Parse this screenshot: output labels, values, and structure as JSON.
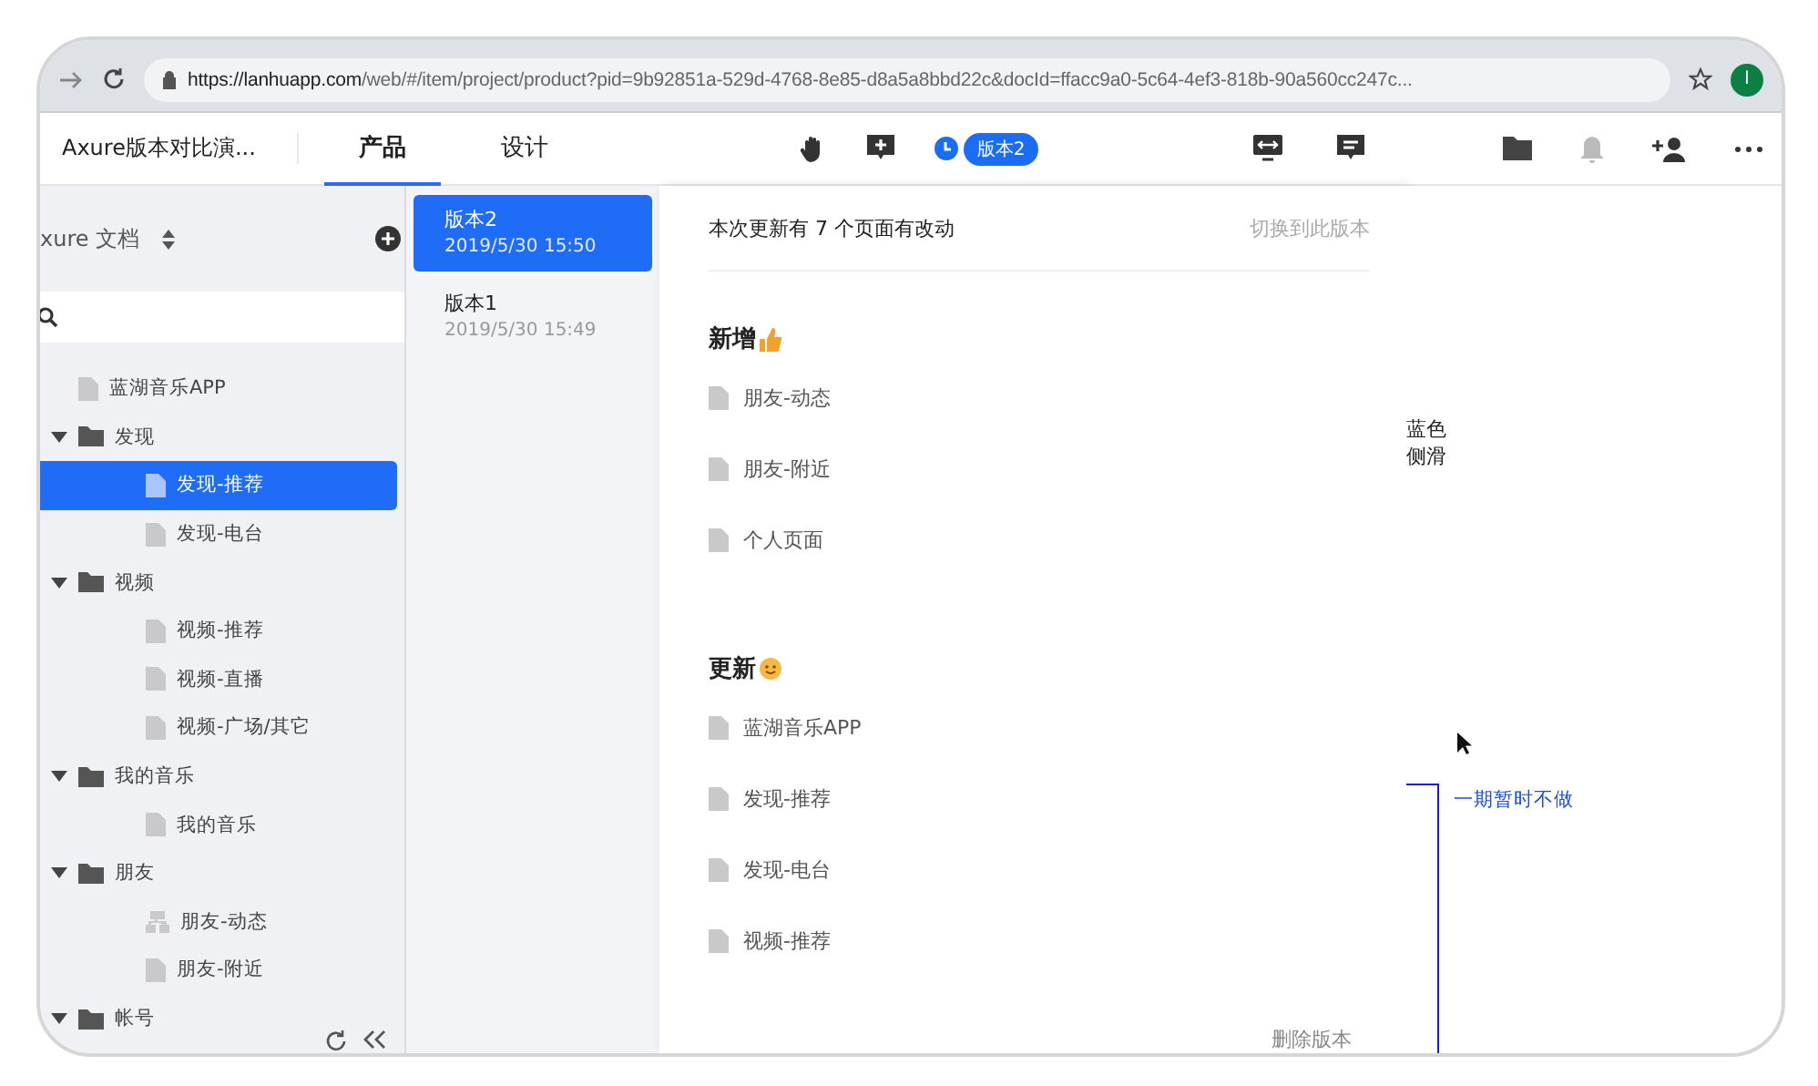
{
  "browser": {
    "url_host": "https://lanhuapp.com",
    "url_path": "/web/#/item/project/product?pid=9b92851a-529d-4768-8e85-d8a5a8bbd22c&docId=ffacc9a0-5c64-4ef3-818b-90a560cc247c...",
    "avatar": "I"
  },
  "app_bar": {
    "project_title": "Axure版本对比演...",
    "tabs": [
      {
        "label": "产品",
        "selected": true
      },
      {
        "label": "设计",
        "selected": false
      }
    ],
    "version_badge": "版本2"
  },
  "sidebar": {
    "doc_title": "xure 文档",
    "tree": [
      {
        "label": "蓝湖音乐APP",
        "kind": "page",
        "selected": false
      },
      {
        "label": "发现",
        "kind": "folder",
        "expanded": true,
        "selected": false,
        "children": [
          {
            "label": "发现-推荐",
            "kind": "page",
            "selected": true
          },
          {
            "label": "发现-电台",
            "kind": "page",
            "selected": false
          }
        ]
      },
      {
        "label": "视频",
        "kind": "folder",
        "expanded": true,
        "selected": false,
        "children": [
          {
            "label": "视频-推荐",
            "kind": "page",
            "selected": false
          },
          {
            "label": "视频-直播",
            "kind": "page",
            "selected": false
          },
          {
            "label": "视频-广场/其它",
            "kind": "page",
            "selected": false
          }
        ]
      },
      {
        "label": "我的音乐",
        "kind": "folder",
        "expanded": true,
        "selected": false,
        "children": [
          {
            "label": "我的音乐",
            "kind": "page",
            "selected": false
          }
        ]
      },
      {
        "label": "朋友",
        "kind": "folder",
        "expanded": true,
        "selected": false,
        "children": [
          {
            "label": "朋友-动态",
            "kind": "flow",
            "selected": false
          },
          {
            "label": "朋友-附近",
            "kind": "page",
            "selected": false
          }
        ]
      },
      {
        "label": "帐号",
        "kind": "folder",
        "expanded": true,
        "selected": false
      }
    ]
  },
  "versions": [
    {
      "name": "版本2",
      "time": "2019/5/30 15:50",
      "selected": true
    },
    {
      "name": "版本1",
      "time": "2019/5/30 15:49",
      "selected": false
    }
  ],
  "changes": {
    "summary": "本次更新有 7 个页面有改动",
    "switch_link": "切换到此版本",
    "sections": [
      {
        "title": "新增",
        "kind": "added",
        "pages": [
          "朋友-动态",
          "朋友-附近",
          "个人页面"
        ]
      },
      {
        "title": "更新",
        "kind": "updated",
        "pages": [
          "蓝湖音乐APP",
          "发现-推荐",
          "发现-电台",
          "视频-推荐"
        ]
      }
    ],
    "delete_link": "删除版本"
  },
  "canvas": {
    "notes": [
      "蓝色",
      "侧滑"
    ],
    "annotation": "一期暂时不做"
  }
}
